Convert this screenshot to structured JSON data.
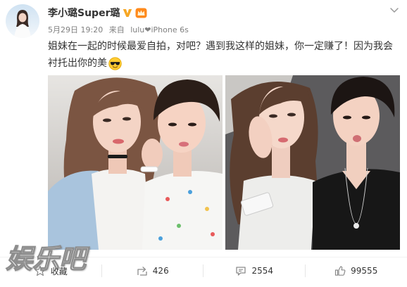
{
  "author": {
    "name": "李小璐Super璐",
    "avatar_icon": "avatar-image",
    "verified_icon": "verified-v-icon",
    "vip_icon": "vip-crown-icon"
  },
  "menu_icon": "chevron-down-icon",
  "meta": {
    "time": "5月29日 19:20",
    "source_prefix": "来自",
    "source": "lulu❤iPhone 6s"
  },
  "post": {
    "text_lines": [
      "姐妹在一起的时候最爱自拍，对吧？遇到我这样的姐妹，你一定赚了！因为我会",
      "衬托出你的美"
    ],
    "emoji_icon": "sunglasses-emoji-icon"
  },
  "actions": [
    {
      "icon": "star-icon",
      "label": "收藏"
    },
    {
      "icon": "repost-icon",
      "label": "426"
    },
    {
      "icon": "comment-icon",
      "label": "2554"
    },
    {
      "icon": "like-icon",
      "label": "99555"
    }
  ],
  "watermark": {
    "text": "娱乐吧"
  },
  "colors": {
    "text": "#333333",
    "meta": "#808080",
    "verified": "#f6a623",
    "vip": "#ff8a1c",
    "icon": "#8a8a8a",
    "divider": "#e6e6e6"
  }
}
